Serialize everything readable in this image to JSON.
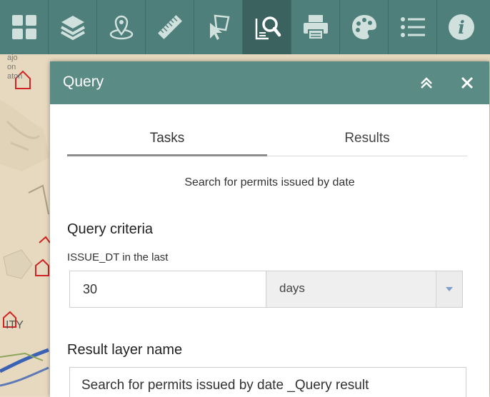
{
  "toolbar": {
    "tools": [
      {
        "icon": "grid-icon"
      },
      {
        "icon": "layers-icon"
      },
      {
        "icon": "location-pin-icon"
      },
      {
        "icon": "ruler-icon"
      },
      {
        "icon": "select-icon"
      },
      {
        "icon": "query-icon",
        "active": true
      },
      {
        "icon": "print-icon"
      },
      {
        "icon": "palette-icon"
      },
      {
        "icon": "list-icon"
      },
      {
        "icon": "info-icon"
      }
    ]
  },
  "map": {
    "labels": [
      "ajo",
      "on",
      "aton",
      "ITY"
    ]
  },
  "panel": {
    "title": "Query",
    "tabs": [
      "Tasks",
      "Results"
    ],
    "description": "Search for permits issued by date",
    "criteria": {
      "heading": "Query criteria",
      "field_label": "ISSUE_DT in the last",
      "number_value": "30",
      "unit_value": "days"
    },
    "result": {
      "heading": "Result layer name",
      "value": "Search for permits issued by date _Query result"
    }
  },
  "colors": {
    "toolbar": "#4f7f7a",
    "header": "#5b8b85"
  }
}
